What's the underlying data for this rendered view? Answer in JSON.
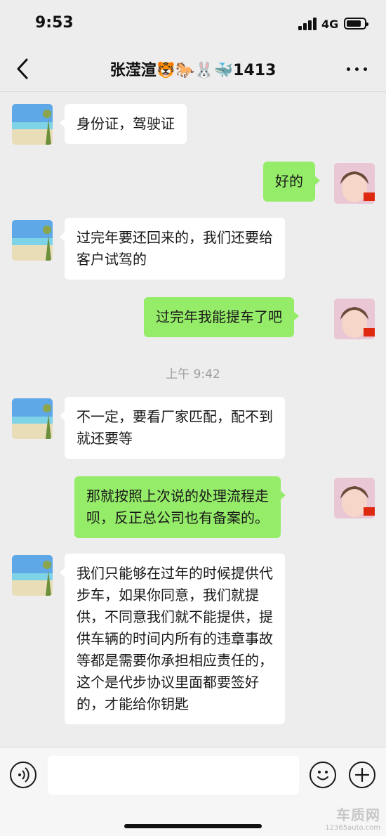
{
  "status_bar": {
    "time": "9:53",
    "network": "4G"
  },
  "nav": {
    "title": "张滢渲🐯🐎🐰🐳1413"
  },
  "messages": [
    {
      "side": "in",
      "lines": [
        "身份证，驾驶证"
      ]
    },
    {
      "side": "out",
      "lines": [
        "好的"
      ]
    },
    {
      "side": "in",
      "lines": [
        "过完年要还回来的，我们还要给",
        "客户试驾的"
      ]
    },
    {
      "side": "out",
      "lines": [
        "过完年我能提车了吧"
      ]
    },
    {
      "side": "in",
      "lines": [
        "不一定，要看厂家匹配，配不到",
        "就还要等"
      ]
    },
    {
      "side": "out",
      "lines": [
        "那就按照上次说的处理流程走",
        "呗，反正总公司也有备案的。"
      ]
    },
    {
      "side": "in",
      "lines": [
        "我们只能够在过年的时候提供代",
        "步车，如果你同意，我们就提",
        "供，不同意我们就不能提供，提",
        "供车辆的时间内所有的违章事故",
        "等都是需要你承担相应责任的，",
        "这个是代步协议里面都要签好",
        "的，才能给你钥匙"
      ]
    }
  ],
  "time_separator": "上午 9:42",
  "watermark": {
    "main": "车质网",
    "sub": "12365auto.com"
  },
  "colors": {
    "background": "#ededed",
    "incoming_bubble": "#ffffff",
    "outgoing_bubble": "#95ec69"
  },
  "icons": {
    "back": "chevron-left-icon",
    "more": "more-dots-icon",
    "voice": "voice-icon",
    "emoji": "emoji-icon",
    "plus": "plus-icon"
  }
}
